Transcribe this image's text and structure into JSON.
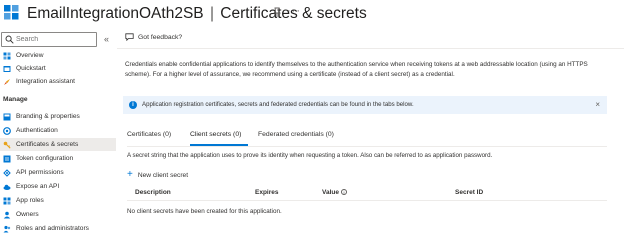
{
  "header": {
    "app_name": "EmailIntegrationOAth2SB",
    "separator": "|",
    "page_title": "Certificates & secrets"
  },
  "sidebar": {
    "search_placeholder": "Search",
    "collapse_glyph": "«",
    "items_top": [
      {
        "label": "Overview",
        "icon": "overview-icon"
      },
      {
        "label": "Quickstart",
        "icon": "quickstart-icon"
      },
      {
        "label": "Integration assistant",
        "icon": "rocket-icon"
      }
    ],
    "section_label": "Manage",
    "items_manage": [
      {
        "label": "Branding & properties",
        "icon": "branding-icon"
      },
      {
        "label": "Authentication",
        "icon": "authentication-icon"
      },
      {
        "label": "Certificates & secrets",
        "icon": "key-icon",
        "active": true
      },
      {
        "label": "Token configuration",
        "icon": "token-icon"
      },
      {
        "label": "API permissions",
        "icon": "permissions-icon"
      },
      {
        "label": "Expose an API",
        "icon": "cloud-icon"
      },
      {
        "label": "App roles",
        "icon": "app-roles-icon"
      },
      {
        "label": "Owners",
        "icon": "owners-icon"
      },
      {
        "label": "Roles and administrators",
        "icon": "roles-icon"
      }
    ]
  },
  "main": {
    "feedback_label": "Got feedback?",
    "intro_text": "Credentials enable confidential applications to identify themselves to the authentication service when receiving tokens at a web addressable location (using an HTTPS scheme). For a higher level of assurance, we recommend using a certificate (instead of a client secret) as a credential.",
    "info_banner": "Application registration certificates, secrets and federated credentials can be found in the tabs below.",
    "close_glyph": "×",
    "tabs": [
      {
        "label": "Certificates (0)"
      },
      {
        "label": "Client secrets (0)",
        "active": true
      },
      {
        "label": "Federated credentials (0)"
      }
    ],
    "description": "A secret string that the application uses to prove its identity when requesting a token. Also can be referred to as application password.",
    "new_secret_label": "New client secret",
    "table": {
      "columns": [
        "Description",
        "Expires",
        "Value",
        "Secret ID"
      ],
      "empty_message": "No client secrets have been created for this application."
    }
  },
  "colors": {
    "accent": "#0078d4",
    "info_background": "#ebf3fc",
    "active_nav": "#edebe9"
  }
}
